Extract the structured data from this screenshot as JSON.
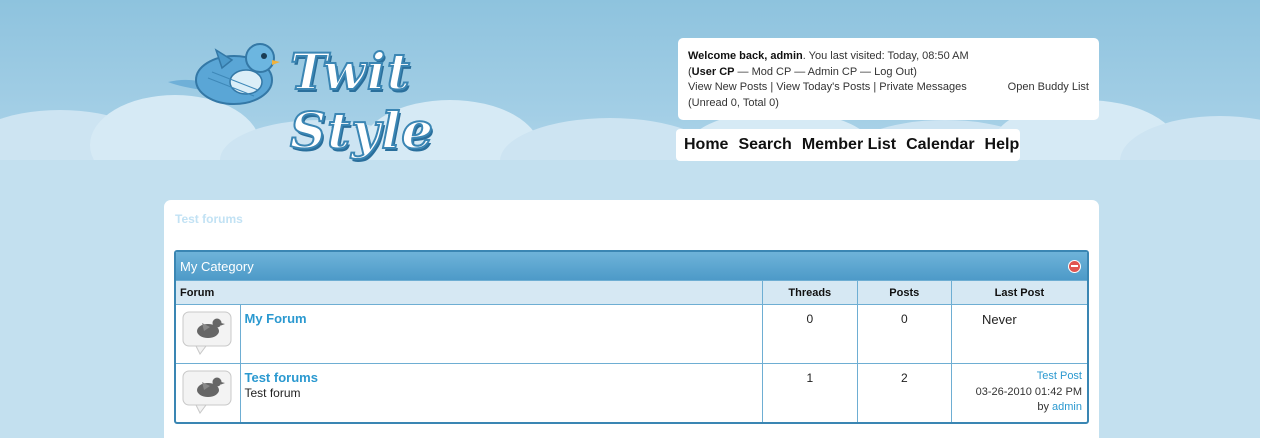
{
  "header": {
    "logo_text": "Twit Style"
  },
  "welcome": {
    "greeting": "Welcome back, admin",
    "last_visit": ". You last visited: Today, 08:50 AM",
    "user_cp": "User CP",
    "mod_cp": "Mod CP",
    "admin_cp": "Admin CP",
    "log_out": "Log Out",
    "sep": " — ",
    "view_new_posts": "View New Posts",
    "view_todays_posts": "View Today's Posts",
    "private_messages": "Private Messages",
    "pipe": " | ",
    "buddy_list": "Open Buddy List",
    "pm_counts": "(Unread 0, Total 0)"
  },
  "menu": {
    "items": [
      "Home",
      "Search",
      "Member List",
      "Calendar",
      "Help"
    ]
  },
  "breadcrumb": "Test forums",
  "category": {
    "title": "My Category",
    "columns": [
      "Forum",
      "Threads",
      "Posts",
      "Last Post"
    ],
    "forums": [
      {
        "name": "My Forum",
        "description": "",
        "threads": "0",
        "posts": "0",
        "last_post_text": "Never"
      },
      {
        "name": "Test forums",
        "description": "Test forum",
        "threads": "1",
        "posts": "2",
        "last_post_title": "Test Post",
        "last_post_date": "03-26-2010 01:42 PM",
        "last_post_by": "by",
        "last_post_user": "admin"
      }
    ]
  },
  "colors": {
    "accent_link": "#2b99d0",
    "category_header": "#4d9ac8",
    "sky": "#8ec3de"
  }
}
